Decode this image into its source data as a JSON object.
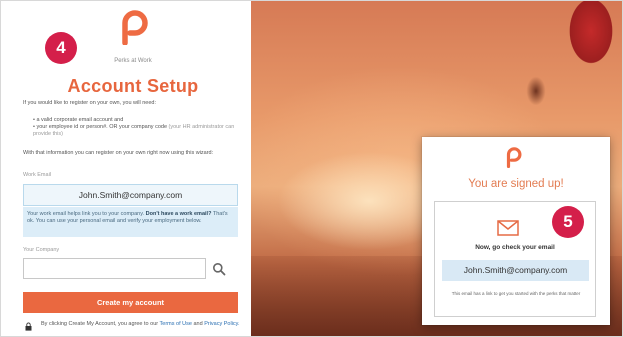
{
  "brand": {
    "name": "Perks at Work",
    "accent_color": "#e7663e",
    "badge_color": "#d41f4a"
  },
  "badges": {
    "step_left": "4",
    "step_right": "5"
  },
  "setup": {
    "title": "Account Setup",
    "intro": "If you would like to register on your own, you will need:",
    "bullet1": "a valid corporate email account and",
    "bullet2_main": "your employee id or person#. OR your company code",
    "bullet2_muted": "(your HR administrator can provide this)",
    "para2": "With that information you can register on your own right now using this wizard:",
    "email_label": "Work Email",
    "email_value": "John.Smith@company.com",
    "info_text": "Your work email helps link you to your company.",
    "info_bold": "Don't have a work email?",
    "info_rest": "That's ok. You can use your personal email and verify your employment below.",
    "company_label": "Your Company",
    "company_value": "",
    "create_button": "Create my account",
    "terms_prefix": "By clicking Create My Account, you agree to our",
    "terms_link": "Terms of Use",
    "terms_and": "and",
    "privacy_link": "Privacy Policy."
  },
  "signed_up": {
    "title": "You are signed up!",
    "check_email": "Now, go check your email",
    "email": "John.Smith@company.com",
    "note": "This email has a link to get you started with the perks that matter"
  },
  "icons": {
    "logo": "perks-p-logo",
    "search": "search-icon",
    "mail": "envelope-icon",
    "lock": "lock-icon"
  }
}
